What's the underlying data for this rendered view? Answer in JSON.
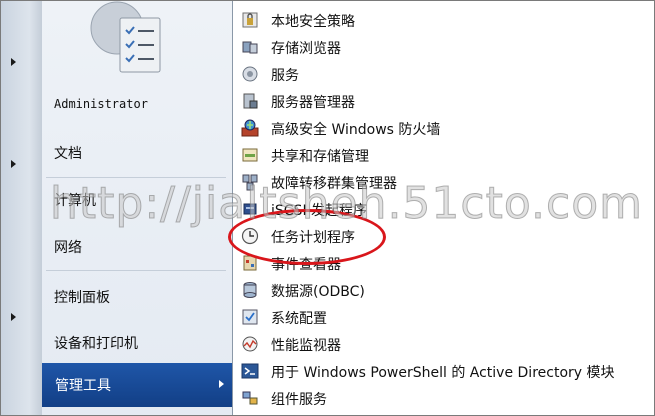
{
  "start_menu": {
    "username": "Administrator",
    "items": [
      {
        "label": "文档"
      },
      {
        "label": "计算机"
      },
      {
        "label": "网络"
      },
      {
        "label": "控制面板"
      },
      {
        "label": "设备和打印机"
      }
    ],
    "selected": {
      "label": "管理工具"
    }
  },
  "admin_tools": {
    "items": [
      {
        "label": "本地安全策略",
        "icon": "security-policy-icon"
      },
      {
        "label": "存储浏览器",
        "icon": "storage-explorer-icon"
      },
      {
        "label": "服务",
        "icon": "services-icon"
      },
      {
        "label": "服务器管理器",
        "icon": "server-manager-icon"
      },
      {
        "label": "高级安全 Windows 防火墙",
        "icon": "firewall-icon"
      },
      {
        "label": "共享和存储管理",
        "icon": "share-storage-icon"
      },
      {
        "label": "故障转移群集管理器",
        "icon": "failover-cluster-icon"
      },
      {
        "label": "iSCSI 发起程序",
        "icon": "iscsi-icon"
      },
      {
        "label": "任务计划程序",
        "icon": "task-scheduler-icon"
      },
      {
        "label": "事件查看器",
        "icon": "event-viewer-icon"
      },
      {
        "label": "数据源(ODBC)",
        "icon": "odbc-icon"
      },
      {
        "label": "系统配置",
        "icon": "system-config-icon"
      },
      {
        "label": "性能监视器",
        "icon": "performance-monitor-icon"
      },
      {
        "label": "用于 Windows PowerShell 的 Active Directory 模块",
        "icon": "powershell-icon"
      },
      {
        "label": "组件服务",
        "icon": "component-services-icon"
      }
    ]
  },
  "watermark": "http://jialtsheh.51cto.com",
  "colors": {
    "highlight": "#1a4d9c",
    "ellipse": "#d9161b"
  }
}
